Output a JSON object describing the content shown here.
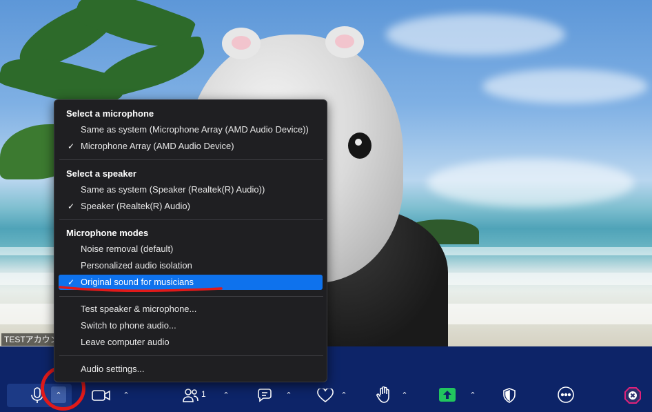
{
  "participant": {
    "name_tag": "TESTアカウント"
  },
  "audio_menu": {
    "microphone_heading": "Select a microphone",
    "microphone_options": [
      {
        "label": "Same as system (Microphone Array (AMD Audio Device))",
        "checked": false
      },
      {
        "label": "Microphone Array (AMD Audio Device)",
        "checked": true
      }
    ],
    "speaker_heading": "Select a speaker",
    "speaker_options": [
      {
        "label": "Same as system (Speaker (Realtek(R) Audio))",
        "checked": false
      },
      {
        "label": "Speaker (Realtek(R) Audio)",
        "checked": true
      }
    ],
    "modes_heading": "Microphone modes",
    "mode_options": [
      {
        "label": "Noise removal (default)",
        "checked": false
      },
      {
        "label": "Personalized audio isolation",
        "checked": false
      },
      {
        "label": "Original sound for musicians",
        "checked": true
      }
    ],
    "actions": [
      "Test speaker & microphone...",
      "Switch to phone audio...",
      "Leave computer audio"
    ],
    "settings": "Audio settings...",
    "check_glyph": "✓"
  },
  "toolbar": {
    "participants_count": "1",
    "caret_glyph": "⌃",
    "icons": [
      "microphone-icon",
      "caret-up-icon",
      "video-camera-icon",
      "participants-icon",
      "chat-icon",
      "reactions-heart-icon",
      "raise-hand-icon",
      "share-screen-icon",
      "security-shield-icon",
      "more-icon",
      "leave-icon"
    ]
  },
  "colors": {
    "toolbar_bg": "#0d2468",
    "menu_bg": "#1f1f22",
    "selected": "#0e72ed",
    "share_green": "#22c55e",
    "annotation_red": "#e11a1a"
  }
}
